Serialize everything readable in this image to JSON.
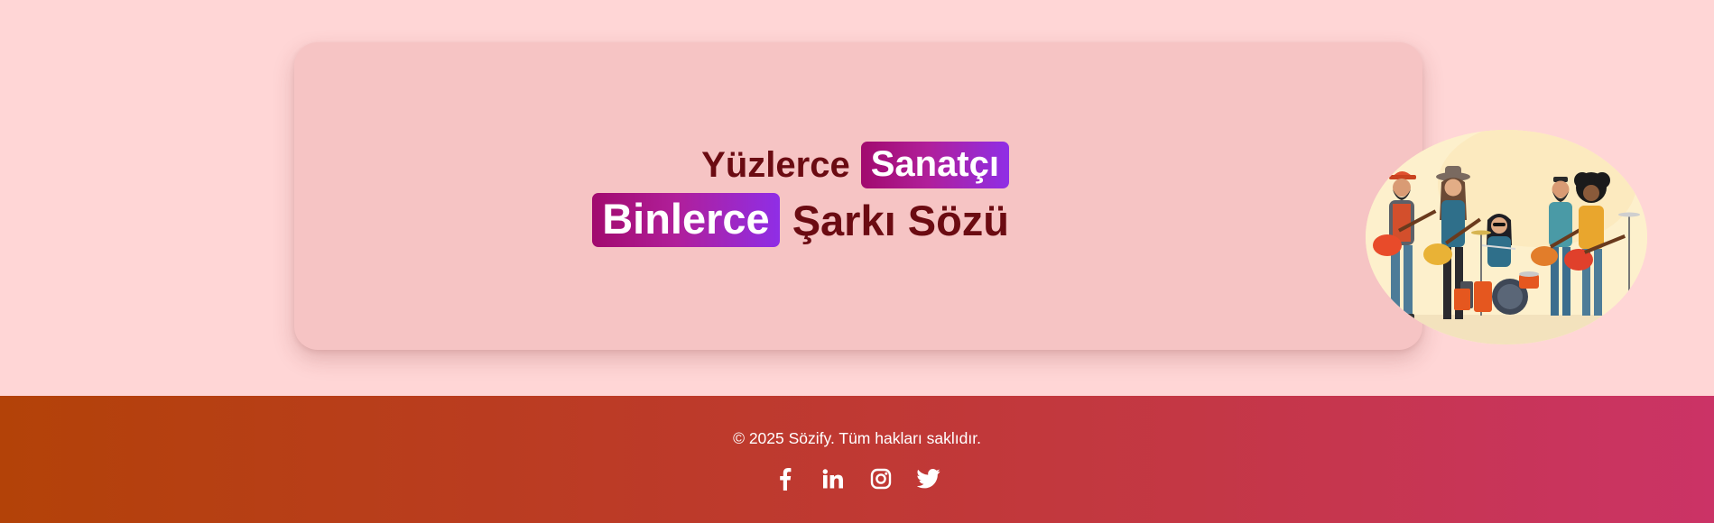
{
  "hero": {
    "line1_text": "Yüzlerce",
    "line1_highlight": "Sanatçı",
    "line2_highlight": "Binlerce",
    "line2_text": "Şarkı Sözü",
    "image_alt": "Sahnede çalan müzik grubu illüstrasyonu"
  },
  "footer": {
    "copyright": "© 2025 Sözify. Tüm hakları saklıdır.",
    "social": [
      {
        "icon": "facebook-icon",
        "label": "Facebook"
      },
      {
        "icon": "linkedin-icon",
        "label": "LinkedIn"
      },
      {
        "icon": "instagram-icon",
        "label": "Instagram"
      },
      {
        "icon": "twitter-icon",
        "label": "Twitter"
      }
    ]
  },
  "colors": {
    "page_background": "#ffd6d6",
    "card_background": "#f6c4c4",
    "headline_text": "#6b0b12",
    "pill_gradient_start": "#a10a6e",
    "pill_gradient_end": "#8f2ee6",
    "footer_gradient_start": "#b34208",
    "footer_gradient_end": "#cb3366"
  }
}
